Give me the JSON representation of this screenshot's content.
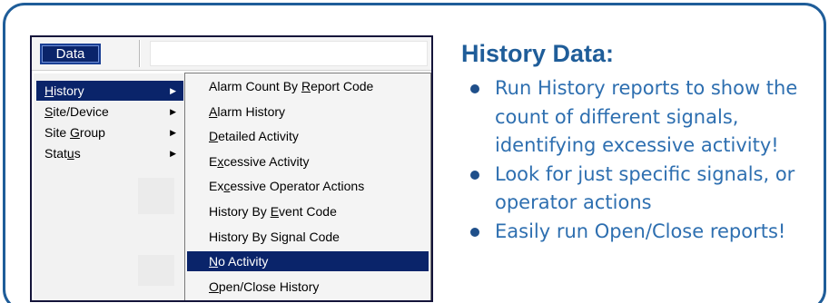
{
  "menu": {
    "bar_label": "Data",
    "submenu": [
      {
        "before": "",
        "ul": "H",
        "after": "istory",
        "active": true
      },
      {
        "before": "",
        "ul": "S",
        "after": "ite/Device",
        "active": false
      },
      {
        "before": "Site ",
        "ul": "G",
        "after": "roup",
        "active": false
      },
      {
        "before": "Stat",
        "ul": "u",
        "after": "s",
        "active": false
      }
    ],
    "history_items": [
      {
        "before": "Alarm Count By ",
        "ul": "R",
        "after": "eport Code",
        "active": false
      },
      {
        "before": "",
        "ul": "A",
        "after": "larm History",
        "active": false
      },
      {
        "before": "",
        "ul": "D",
        "after": "etailed Activity",
        "active": false
      },
      {
        "before": "E",
        "ul": "x",
        "after": "cessive Activity",
        "active": false
      },
      {
        "before": "Ex",
        "ul": "c",
        "after": "essive Operator Actions",
        "active": false
      },
      {
        "before": "History By ",
        "ul": "E",
        "after": "vent Code",
        "active": false
      },
      {
        "before": "History By Si",
        "ul": "g",
        "after": "nal Code",
        "active": false
      },
      {
        "before": "",
        "ul": "N",
        "after": "o Activity",
        "active": true
      },
      {
        "before": "",
        "ul": "O",
        "after": "pen/Close History",
        "active": false
      }
    ]
  },
  "info": {
    "heading": "History Data:",
    "bullets": [
      "Run History reports to show the count of different signals, identifying excessive activity!",
      "Look for just specific signals, or operator actions",
      "Easily run Open/Close reports!"
    ]
  },
  "colors": {
    "frame": "#1f5d99",
    "menu_highlight": "#0a246a",
    "bullet_text": "#2e6fb0"
  }
}
